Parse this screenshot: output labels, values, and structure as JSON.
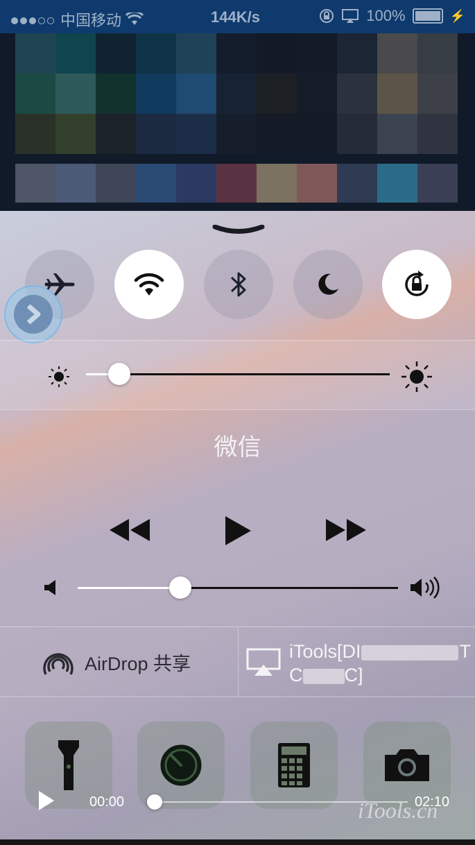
{
  "status_bar": {
    "carrier": "中国移动",
    "network_speed": "144K/s",
    "battery": "100%",
    "signal_bars": 5,
    "signal_filled": 3
  },
  "control_center": {
    "toggles": [
      {
        "name": "airplane-mode",
        "icon": "airplane-icon",
        "on": false
      },
      {
        "name": "wifi",
        "icon": "wifi-icon",
        "on": true
      },
      {
        "name": "bluetooth",
        "icon": "bluetooth-icon",
        "on": false
      },
      {
        "name": "do-not-disturb",
        "icon": "moon-icon",
        "on": false
      },
      {
        "name": "rotation-lock",
        "icon": "rotation-lock-icon",
        "on": true
      }
    ],
    "brightness_level": 0.11,
    "now_playing": "微信",
    "volume_level": 0.32,
    "airdrop_label": "AirDrop 共享",
    "airplay_label_line1": "iTools[DI",
    "airplay_label_line1_end": "T",
    "airplay_label_line2_start": "C",
    "airplay_label_line2_end": "C]",
    "tools": [
      {
        "name": "flashlight",
        "icon": "flashlight-icon"
      },
      {
        "name": "timer",
        "icon": "timer-icon"
      },
      {
        "name": "calculator",
        "icon": "calculator-icon"
      },
      {
        "name": "camera",
        "icon": "camera-icon"
      }
    ]
  },
  "video_player": {
    "current_time": "00:00",
    "total_time": "02:10",
    "progress": 0.0
  },
  "watermark": "iTools.cn",
  "colors": {
    "status_bar_bg": "#0f3a6e",
    "toggle_on": "#ffffff",
    "toggle_off": "rgba(150,150,170,0.35)"
  }
}
